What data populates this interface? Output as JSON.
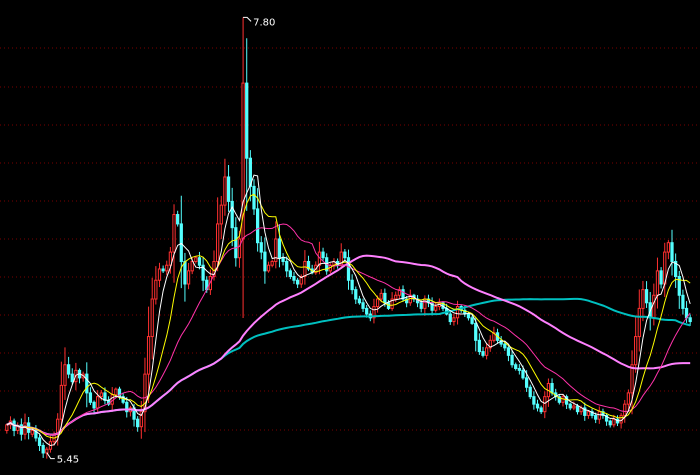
{
  "chart_data": {
    "type": "candlestick",
    "high_marker": {
      "index": 65,
      "value": 7.8,
      "label": "7.80"
    },
    "low_marker": {
      "index": 11,
      "value": 5.45,
      "label": "5.45"
    },
    "ylim": [
      5.4,
      7.85
    ],
    "grid": true,
    "colors": {
      "background": "#000000",
      "up": "#ff3030",
      "down": "#54ffff",
      "grid": "#7a0000",
      "ma5": "#ffffff",
      "ma10": "#ffff00",
      "ma20": "#ff33aa",
      "ma60": "#ff80ff",
      "ma120": "#00c0c0",
      "marker": "#ffffff"
    },
    "close": [
      5.63,
      5.65,
      5.6,
      5.62,
      5.58,
      5.64,
      5.59,
      5.6,
      5.56,
      5.52,
      5.48,
      5.5,
      5.54,
      5.58,
      5.66,
      5.84,
      5.95,
      5.9,
      5.86,
      5.92,
      5.88,
      5.9,
      5.8,
      5.75,
      5.72,
      5.78,
      5.8,
      5.76,
      5.74,
      5.79,
      5.82,
      5.78,
      5.75,
      5.7,
      5.72,
      5.66,
      5.62,
      5.7,
      5.9,
      6.1,
      6.3,
      6.4,
      6.46,
      6.45,
      6.48,
      6.55,
      6.75,
      6.7,
      6.5,
      6.38,
      6.45,
      6.5,
      6.52,
      6.48,
      6.4,
      6.35,
      6.42,
      6.5,
      6.7,
      6.8,
      6.95,
      6.82,
      6.68,
      6.52,
      6.62,
      7.45,
      7.05,
      6.9,
      6.78,
      6.6,
      6.55,
      6.45,
      6.48,
      6.5,
      6.62,
      6.52,
      6.5,
      6.45,
      6.42,
      6.4,
      6.38,
      6.42,
      6.5,
      6.46,
      6.44,
      6.48,
      6.55,
      6.52,
      6.45,
      6.48,
      6.5,
      6.48,
      6.55,
      6.52,
      6.4,
      6.35,
      6.3,
      6.28,
      6.25,
      6.22,
      6.2,
      6.26,
      6.3,
      6.33,
      6.28,
      6.25,
      6.3,
      6.32,
      6.35,
      6.3,
      6.28,
      6.32,
      6.3,
      6.28,
      6.25,
      6.3,
      6.28,
      6.24,
      6.26,
      6.28,
      6.25,
      6.22,
      6.18,
      6.2,
      6.26,
      6.24,
      6.22,
      6.2,
      6.17,
      6.08,
      6.02,
      6.0,
      6.04,
      6.08,
      6.12,
      6.08,
      6.06,
      6.04,
      6.0,
      5.95,
      5.93,
      5.92,
      5.88,
      5.83,
      5.78,
      5.74,
      5.72,
      5.7,
      5.78,
      5.85,
      5.8,
      5.78,
      5.75,
      5.78,
      5.74,
      5.72,
      5.73,
      5.7,
      5.72,
      5.68,
      5.7,
      5.68,
      5.66,
      5.7,
      5.68,
      5.65,
      5.63,
      5.66,
      5.64,
      5.68,
      5.74,
      5.8,
      5.95,
      6.1,
      6.25,
      6.35,
      6.28,
      6.2,
      6.32,
      6.45,
      6.38,
      6.55,
      6.6,
      6.5,
      6.42,
      6.32,
      6.25,
      6.2,
      6.18
    ],
    "open": [
      5.6,
      5.63,
      5.65,
      5.6,
      5.63,
      5.58,
      5.64,
      5.58,
      5.6,
      5.56,
      5.52,
      5.48,
      5.5,
      5.54,
      5.58,
      5.66,
      5.84,
      5.95,
      5.9,
      5.86,
      5.92,
      5.88,
      5.9,
      5.8,
      5.75,
      5.72,
      5.78,
      5.8,
      5.76,
      5.74,
      5.79,
      5.82,
      5.78,
      5.75,
      5.7,
      5.72,
      5.66,
      5.62,
      5.7,
      5.9,
      6.1,
      6.3,
      6.4,
      6.46,
      6.45,
      6.48,
      6.55,
      6.75,
      6.7,
      6.5,
      6.38,
      6.45,
      6.5,
      6.52,
      6.48,
      6.4,
      6.35,
      6.42,
      6.5,
      6.7,
      6.8,
      6.95,
      6.82,
      6.68,
      6.52,
      6.62,
      7.45,
      7.05,
      6.9,
      6.78,
      6.6,
      6.55,
      6.45,
      6.48,
      6.5,
      6.62,
      6.52,
      6.5,
      6.45,
      6.42,
      6.4,
      6.38,
      6.42,
      6.5,
      6.46,
      6.44,
      6.48,
      6.55,
      6.52,
      6.45,
      6.48,
      6.5,
      6.48,
      6.55,
      6.52,
      6.4,
      6.35,
      6.3,
      6.28,
      6.25,
      6.22,
      6.2,
      6.26,
      6.3,
      6.33,
      6.28,
      6.25,
      6.3,
      6.32,
      6.35,
      6.3,
      6.28,
      6.32,
      6.3,
      6.28,
      6.25,
      6.3,
      6.28,
      6.24,
      6.26,
      6.28,
      6.25,
      6.22,
      6.18,
      6.2,
      6.26,
      6.24,
      6.22,
      6.2,
      6.17,
      6.08,
      6.02,
      6.0,
      6.04,
      6.08,
      6.12,
      6.08,
      6.06,
      6.04,
      6.0,
      5.95,
      5.93,
      5.92,
      5.88,
      5.83,
      5.78,
      5.74,
      5.72,
      5.7,
      5.78,
      5.85,
      5.8,
      5.78,
      5.75,
      5.78,
      5.74,
      5.72,
      5.73,
      5.7,
      5.72,
      5.68,
      5.7,
      5.68,
      5.66,
      5.7,
      5.68,
      5.65,
      5.63,
      5.66,
      5.64,
      5.68,
      5.74,
      5.8,
      5.95,
      6.1,
      6.25,
      6.35,
      6.28,
      6.2,
      6.32,
      6.45,
      6.38,
      6.55,
      6.6,
      6.5,
      6.42,
      6.32,
      6.25,
      6.2
    ]
  }
}
